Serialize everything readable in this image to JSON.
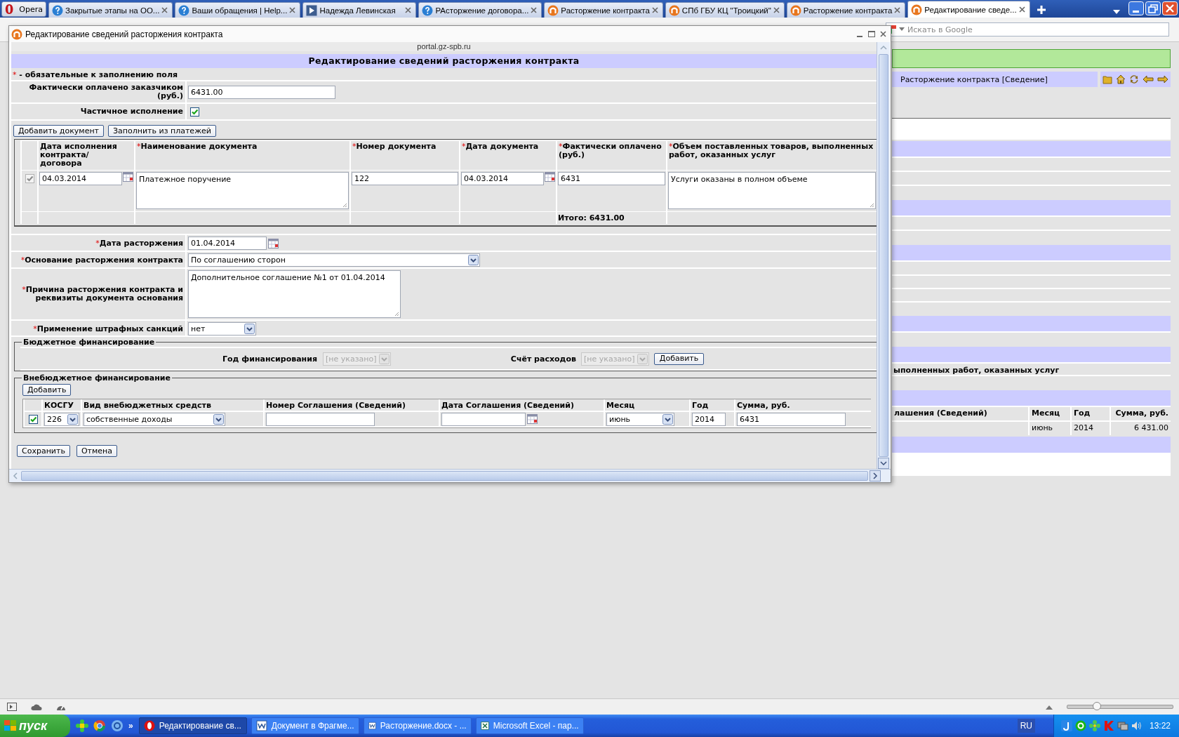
{
  "browser": {
    "menu_button": "Opera",
    "tabs": [
      {
        "label": "Закрытые этапы на ОО...",
        "kind": "help",
        "selected": false
      },
      {
        "label": "Ваши обращения | Help...",
        "kind": "help",
        "selected": false
      },
      {
        "label": "Надежда Левинская",
        "kind": "video",
        "selected": false
      },
      {
        "label": "РАсторжение договора...",
        "kind": "help",
        "selected": false
      },
      {
        "label": "Расторжение контракта",
        "kind": "portal",
        "selected": false
      },
      {
        "label": "СПб ГБУ КЦ \"Троицкий\"",
        "kind": "portal",
        "selected": false
      },
      {
        "label": "Расторжение контракта",
        "kind": "portal",
        "selected": false
      },
      {
        "label": "Редактирование сведе...",
        "kind": "portal",
        "selected": true
      }
    ],
    "search_placeholder": "Искать в Google"
  },
  "background_page": {
    "heading": "Расторжение контракта [Сведение]",
    "section_label": "ыполненных работ, оказанных услуг",
    "table": {
      "columns": [
        "лашения (Сведений)",
        "Месяц",
        "Год",
        "Сумма, руб."
      ],
      "rows": [
        {
          "month": "июнь",
          "year": "2014",
          "sum": "6 431.00"
        }
      ]
    }
  },
  "dialog": {
    "window_title": "Редактирование сведений расторжения контракта",
    "site": "portal.gz-spb.ru",
    "heading": "Редактирование сведений расторжения контракта",
    "required_note": {
      "mark": "*",
      "text": "- обязательные к заполнению поля"
    },
    "paid_by_customer": {
      "label": "Фактически оплачено заказчиком (руб.)",
      "value": "6431.00"
    },
    "partial_execution": {
      "label": "Частичное исполнение",
      "checked": true
    },
    "document_buttons": [
      "Добавить документ",
      "Заполнить из платежей"
    ],
    "documents": {
      "columns": [
        {
          "label": "Дата исполнения контракта/ договора"
        },
        {
          "mark": "*",
          "label": "Наименование документа"
        },
        {
          "mark": "*",
          "label": "Номер документа"
        },
        {
          "mark": "*",
          "label": "Дата документа"
        },
        {
          "mark": "*",
          "label": "Фактически оплачено (руб.)"
        },
        {
          "mark": "*",
          "label": "Объем поставленных товаров, выполненных работ, оказанных услуг"
        }
      ],
      "rows": [
        {
          "checked": true,
          "disabled": true,
          "execution_date": "04.03.2014",
          "name": "Платежное поручение",
          "number": "122",
          "date": "04.03.2014",
          "paid": "6431",
          "volume": "Услуги оказаны в полном объеме"
        }
      ],
      "total": "Итого: 6431.00"
    },
    "termination_date": {
      "mark": "*",
      "label": "Дата расторжения",
      "value": "01.04.2014"
    },
    "termination_basis": {
      "mark": "*",
      "label": "Основание расторжения контракта",
      "value": "По соглашению сторон"
    },
    "termination_reason": {
      "mark": "*",
      "label": "Причина расторжения контракта и реквизиты документа основания",
      "value": "Дополнительное соглашение №1 от 01.04.2014"
    },
    "penalties": {
      "mark": "*",
      "label": "Применение штрафных санкций",
      "value": "нет"
    },
    "budget_financing": {
      "legend": "Бюджетное финансирование",
      "year": {
        "label": "Год финансирования",
        "value": "[не указано]",
        "disabled": true
      },
      "expense_account": {
        "label": "Счёт расходов",
        "value": "[не указано]",
        "disabled": true
      },
      "add_button": "Добавить"
    },
    "extrabudgetary_financing": {
      "legend": "Внебюджетное финансирование",
      "add_button": "Добавить",
      "columns": [
        "КОСГУ",
        "Вид внебюджетных средств",
        "Номер Соглашения (Сведений)",
        "Дата Соглашения (Сведений)",
        "Месяц",
        "Год",
        "Сумма, руб."
      ],
      "rows": [
        {
          "checked": true,
          "kosgu": "226",
          "fund_type": "собственные доходы",
          "month": "июнь",
          "year": "2014",
          "sum": "6431"
        }
      ]
    },
    "footer_buttons": [
      "Сохранить",
      "Отмена"
    ]
  },
  "status_bar": {
    "zoom": {
      "level": 0.28
    }
  },
  "taskbar": {
    "start_button": "пуск",
    "quick_launch_more": "»",
    "tasks": [
      {
        "label": "Редактирование св...",
        "kind": "opera",
        "selected": true
      },
      {
        "label": "Документ в Фрагме...",
        "kind": "word",
        "selected": false
      },
      {
        "label": "Расторжение.docx - ...",
        "kind": "word",
        "selected": false
      },
      {
        "label": "Microsoft Excel - пар...",
        "kind": "excel",
        "selected": false
      }
    ],
    "language": "RU",
    "clock": "13:22"
  }
}
